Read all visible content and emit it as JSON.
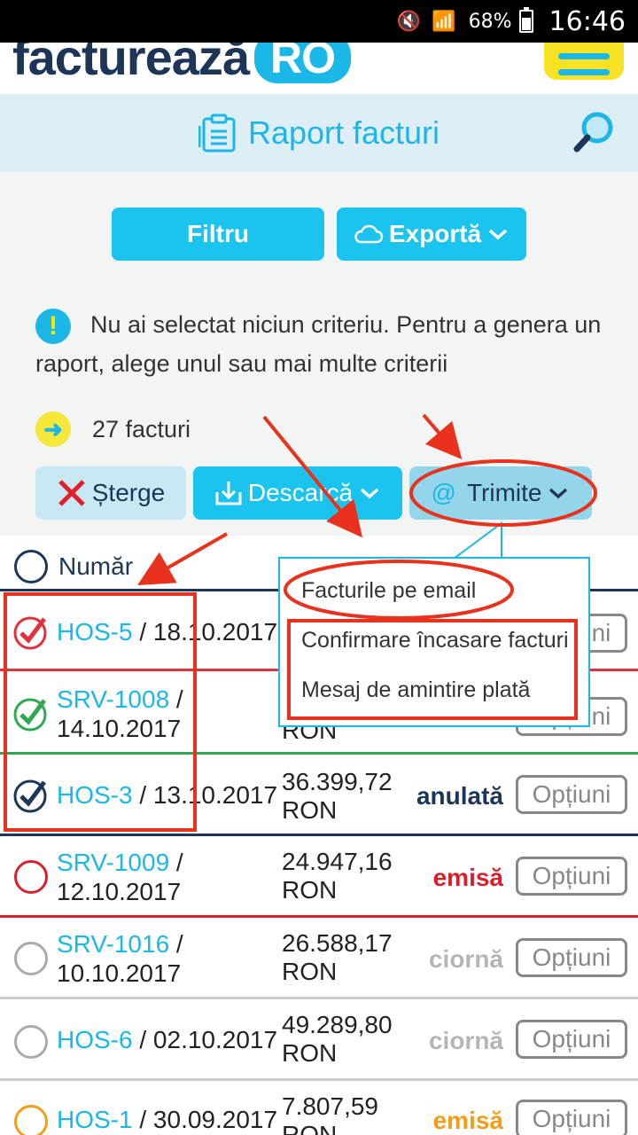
{
  "status_bar": {
    "battery": "68%",
    "time": "16:46"
  },
  "header": {
    "logo_main": "facturează",
    "logo_suffix": "RO"
  },
  "title_bar": {
    "title": "Raport facturi"
  },
  "toolbar": {
    "filter": "Filtru",
    "export": "Exportă"
  },
  "info": {
    "message": "Nu ai selectat niciun criteriu. Pentru a genera un raport, alege unul sau mai multe criterii"
  },
  "count": {
    "label": "27 facturi"
  },
  "actions": {
    "delete": "Șterge",
    "download": "Descarcă",
    "send": "Trimite"
  },
  "table": {
    "header_number": "Număr",
    "rows": [
      {
        "code": "HOS-5",
        "date": "18.10.2017",
        "amount": "",
        "currency": "",
        "status": "",
        "options": "Opțiuni",
        "color": "#e0313c"
      },
      {
        "code": "SRV-1008",
        "date": "14.10.2017",
        "amount": "",
        "currency": "RON",
        "status": "",
        "options": "Opțiuni",
        "color": "#2fa84f"
      },
      {
        "code": "HOS-3",
        "date": "13.10.2017",
        "amount": "36.399,72",
        "currency": "RON",
        "status": "anulată",
        "options": "Opțiuni",
        "color": "#1d3557"
      },
      {
        "code": "SRV-1009",
        "date": "12.10.2017",
        "amount": "24.947,16",
        "currency": "RON",
        "status": "emisă",
        "options": "Opțiuni",
        "color": "#d91f2b"
      },
      {
        "code": "SRV-1016",
        "date": "10.10.2017",
        "amount": "26.588,17",
        "currency": "RON",
        "status": "ciornă",
        "options": "Opțiuni",
        "color": "#aaaaaa"
      },
      {
        "code": "HOS-6",
        "date": "02.10.2017",
        "amount": "49.289,80",
        "currency": "RON",
        "status": "ciornă",
        "options": "Opțiuni",
        "color": "#aaaaaa"
      },
      {
        "code": "HOS-1",
        "date": "30.09.2017",
        "amount": "7.807,59",
        "currency": "RON",
        "status": "emisă",
        "options": "Opțiuni",
        "color": "#f39c1a"
      }
    ]
  },
  "dropdown": {
    "items": [
      "Facturile pe email",
      "Confirmare încasare facturi",
      "Mesaj de amintire plată"
    ]
  },
  "colors": {
    "accent": "#1bc3ef",
    "brand_dark": "#1d3557",
    "annotation": "#e8321e",
    "menu_yellow": "#f7e224"
  }
}
